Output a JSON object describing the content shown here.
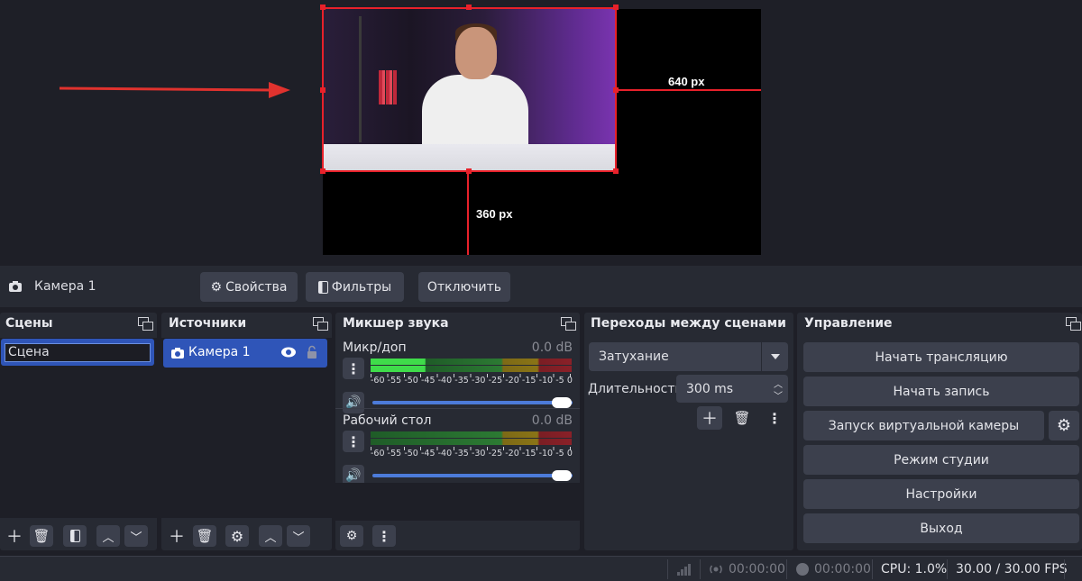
{
  "preview": {
    "width_label": "640 px",
    "height_label": "360 px"
  },
  "source_toolbar": {
    "source_name": "Камера 1",
    "properties_label": "Свойства",
    "filters_label": "Фильтры",
    "deactivate_label": "Отключить"
  },
  "scenes": {
    "title": "Сцены",
    "items": [
      "Сцена"
    ]
  },
  "sources": {
    "title": "Источники",
    "items": [
      "Камера 1"
    ]
  },
  "mixer": {
    "title": "Микшер звука",
    "channels": [
      {
        "name": "Микр/доп",
        "db": "0.0 dB",
        "level": 0.27
      },
      {
        "name": "Рабочий стол",
        "db": "0.0 dB",
        "level": 0.0
      }
    ],
    "ticks": [
      "-60",
      "-55",
      "-50",
      "-45",
      "-40",
      "-35",
      "-30",
      "-25",
      "-20",
      "-15",
      "-10",
      "-5",
      "0"
    ],
    "volume": 1.0
  },
  "transitions": {
    "title": "Переходы между сценами",
    "selected": "Затухание",
    "duration_label": "Длительность",
    "duration_value": "300 ms"
  },
  "controls": {
    "title": "Управление",
    "start_stream": "Начать трансляцию",
    "start_record": "Начать запись",
    "virtual_cam": "Запуск виртуальной камеры",
    "studio_mode": "Режим студии",
    "settings": "Настройки",
    "exit": "Выход"
  },
  "status": {
    "stream_time": "00:00:00",
    "record_time": "00:00:00",
    "cpu": "CPU: 1.0%",
    "fps": "30.00 / 30.00 FPS"
  },
  "colors": {
    "selection": "#e8212a",
    "accent_blue": "#2f55b8",
    "background": "#1e1f27",
    "panel": "#272a33",
    "button": "#3c404d"
  }
}
